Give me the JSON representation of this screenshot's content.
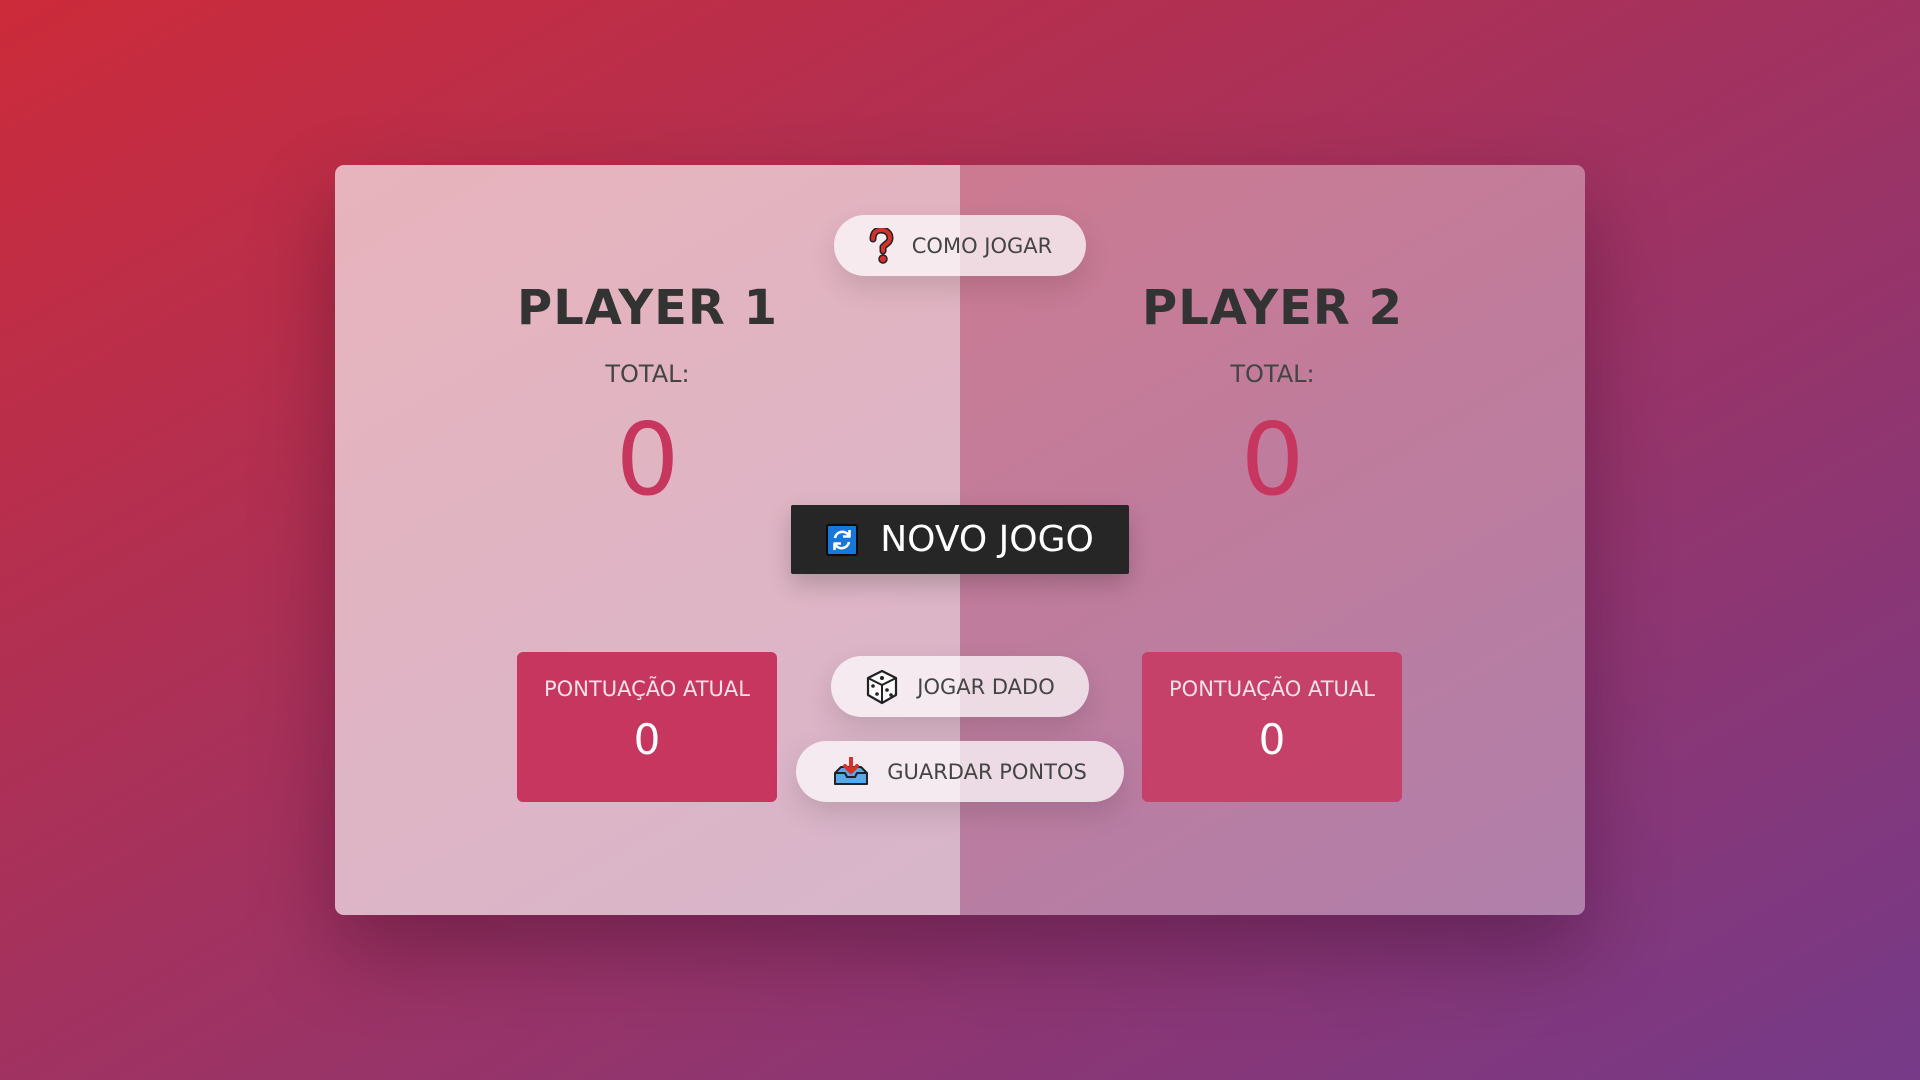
{
  "players": [
    {
      "name": "PLAYER 1",
      "total_label": "TOTAL:",
      "score": "0",
      "current_label": "PONTUAÇÃO ATUAL",
      "current_score": "0"
    },
    {
      "name": "PLAYER 2",
      "total_label": "TOTAL:",
      "score": "0",
      "current_label": "PONTUAÇÃO ATUAL",
      "current_score": "0"
    }
  ],
  "buttons": {
    "help": {
      "label": "COMO JOGAR",
      "icon": "question-mark-icon"
    },
    "new_game": {
      "label": "NOVO JOGO",
      "icon": "refresh-icon"
    },
    "roll": {
      "label": "JOGAR DADO",
      "icon": "dice-icon"
    },
    "hold": {
      "label": "GUARDAR PONTOS",
      "icon": "inbox-download-icon"
    }
  },
  "colors": {
    "accent": "#c7365f",
    "background_start": "#cc2b3a",
    "background_end": "#753a88",
    "new_game_button": "#262626"
  }
}
